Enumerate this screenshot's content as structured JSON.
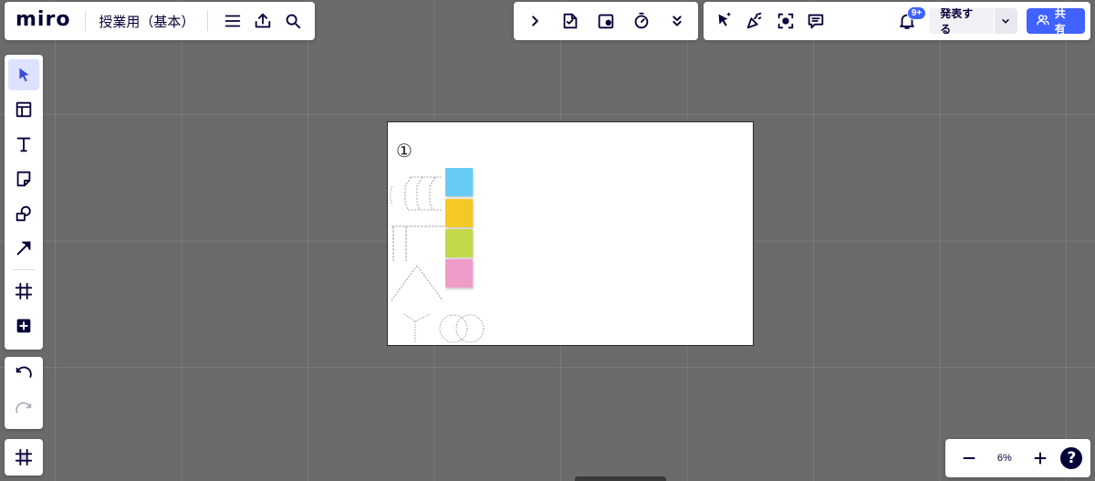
{
  "app": {
    "logo": "miro",
    "board_title": "授業用（基本）"
  },
  "board_bar": {
    "menu_icon": "hamburger-icon",
    "export_icon": "upload-icon",
    "search_icon": "search-icon"
  },
  "collab_bar": {
    "icons": [
      "chevron-right-icon",
      "voting-icon",
      "presentation-card-icon",
      "timer-icon",
      "double-chevron-down-icon"
    ]
  },
  "share_bar": {
    "icons": [
      "cursor-follow-icon",
      "reactions-icon",
      "focus-icon",
      "comment-icon"
    ],
    "notification_badge": "9+",
    "present_label": "発表する",
    "share_label": "共有"
  },
  "left_toolbar": {
    "tools": [
      {
        "name": "select",
        "icon": "cursor-icon",
        "active": true
      },
      {
        "name": "templates",
        "icon": "layout-icon",
        "active": false
      },
      {
        "name": "text",
        "icon": "text-icon",
        "active": false
      },
      {
        "name": "sticky-note",
        "icon": "sticky-note-icon",
        "active": false
      },
      {
        "name": "shapes",
        "icon": "shapes-icon",
        "active": false
      },
      {
        "name": "connection-line",
        "icon": "arrow-icon",
        "active": false
      },
      {
        "name": "frame",
        "icon": "frame-icon",
        "active": false
      },
      {
        "name": "more-apps",
        "icon": "plus-square-icon",
        "active": false
      }
    ]
  },
  "history": {
    "undo_icon": "undo-icon",
    "redo_icon": "redo-icon"
  },
  "frames_panel": {
    "icon": "frames-list-icon"
  },
  "zoom": {
    "level": "6%",
    "help": "?"
  },
  "canvas": {
    "frame_label": "①",
    "sticky_colors": [
      "#66ccf5",
      "#f5c924",
      "#c4d94a",
      "#f09cc8"
    ]
  },
  "colors": {
    "accent": "#4262ff",
    "canvas_bg": "#6b6b6b",
    "ink": "#050038"
  }
}
